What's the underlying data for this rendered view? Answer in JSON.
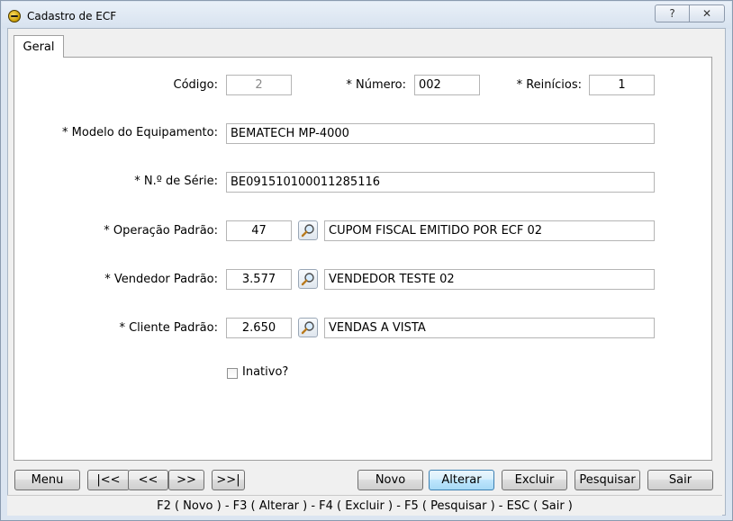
{
  "window": {
    "title": "Cadastro de ECF",
    "help_glyph": "?",
    "close_glyph": "✕"
  },
  "tabs": [
    {
      "label": "Geral",
      "active": true
    }
  ],
  "form": {
    "codigo": {
      "label": "Código:",
      "value": "2",
      "disabled": true
    },
    "numero": {
      "label": "* Número:",
      "value": "002"
    },
    "reinicios": {
      "label": "* Reinícios:",
      "value": "1"
    },
    "modelo": {
      "label": "* Modelo do Equipamento:",
      "value": "BEMATECH MP-4000"
    },
    "serie": {
      "label": "* N.º de Série:",
      "value": "BE091510100011285116"
    },
    "operacao": {
      "label": "* Operação Padrão:",
      "code": "47",
      "description": "CUPOM FISCAL EMITIDO POR ECF 02"
    },
    "vendedor": {
      "label": "* Vendedor Padrão:",
      "code": "3.577",
      "description": "VENDEDOR TESTE 02"
    },
    "cliente": {
      "label": "* Cliente Padrão:",
      "code": "2.650",
      "description": "VENDAS A VISTA"
    },
    "inativo": {
      "label": "Inativo?",
      "checked": false
    }
  },
  "buttons": {
    "menu": "Menu",
    "first": "|<<",
    "prev": "<<",
    "next": ">>",
    "last": ">>|",
    "novo": "Novo",
    "alterar": "Alterar",
    "excluir": "Excluir",
    "pesquisar": "Pesquisar",
    "sair": "Sair"
  },
  "status_bar": "F2 ( Novo )  -  F3 ( Alterar )  -  F4 ( Excluir )  -  F5 ( Pesquisar )  -  ESC ( Sair )",
  "icons": {
    "window": "app-icon",
    "lookup": "search-icon"
  }
}
